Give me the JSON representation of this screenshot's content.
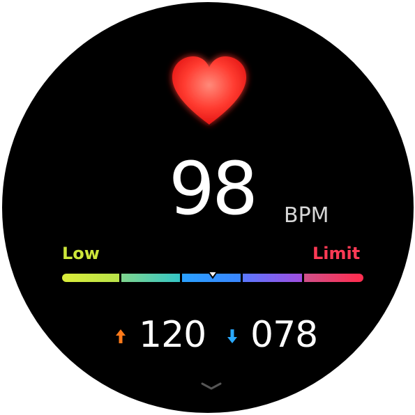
{
  "heart_rate": {
    "value": "98",
    "unit": "BPM",
    "icon": "heart-icon",
    "zone_position": 0.5
  },
  "zones": {
    "low_label": "Low",
    "limit_label": "Limit",
    "colors": [
      "#cde63a",
      "#4fd5a0",
      "#3aa0ff",
      "#8a5cf0",
      "#ff3a55"
    ]
  },
  "stats": {
    "max": {
      "value": "120",
      "icon": "arrow-up-icon",
      "color": "#ff7a1a"
    },
    "min": {
      "value": "078",
      "icon": "arrow-down-icon",
      "color": "#2aa9ff"
    }
  },
  "nav": {
    "more_icon": "chevron-down-icon"
  }
}
